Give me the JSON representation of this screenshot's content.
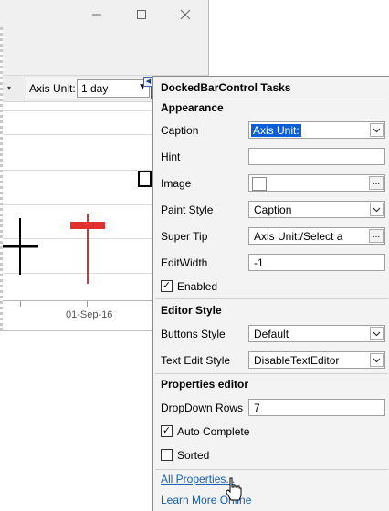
{
  "window": {
    "minimize_icon": "minimize-icon",
    "maximize_icon": "maximize-icon",
    "close_icon": "close-icon"
  },
  "toolbar": {
    "axis_unit_label": "Axis Unit:",
    "axis_unit_value": "1 day"
  },
  "chart": {
    "x_tick_label": "01-Sep-16",
    "colors": {
      "up": "#000000",
      "down": "#e03030"
    }
  },
  "panel": {
    "title": "DockedBarControl Tasks",
    "sections": {
      "appearance": "Appearance",
      "editor_style": "Editor Style",
      "properties_editor": "Properties editor"
    },
    "caption": {
      "label": "Caption",
      "value": "Axis Unit:"
    },
    "hint": {
      "label": "Hint",
      "value": ""
    },
    "image": {
      "label": "Image"
    },
    "paint_style": {
      "label": "Paint Style",
      "value": "Caption"
    },
    "super_tip": {
      "label": "Super Tip",
      "value": "Axis Unit:/Select a"
    },
    "edit_width": {
      "label": "EditWidth",
      "value": "-1"
    },
    "enabled": {
      "label": "Enabled",
      "checked": true
    },
    "buttons_style": {
      "label": "Buttons Style",
      "value": "Default"
    },
    "text_edit_style": {
      "label": "Text Edit Style",
      "value": "DisableTextEditor"
    },
    "dropdown_rows": {
      "label": "DropDown Rows",
      "value": "7"
    },
    "auto_complete": {
      "label": "Auto Complete",
      "checked": true
    },
    "sorted": {
      "label": "Sorted",
      "checked": false
    },
    "links": {
      "all_properties": "All Properties...",
      "learn_more": "Learn More Online"
    },
    "ellipsis": "...",
    "check_mark": "✓"
  }
}
